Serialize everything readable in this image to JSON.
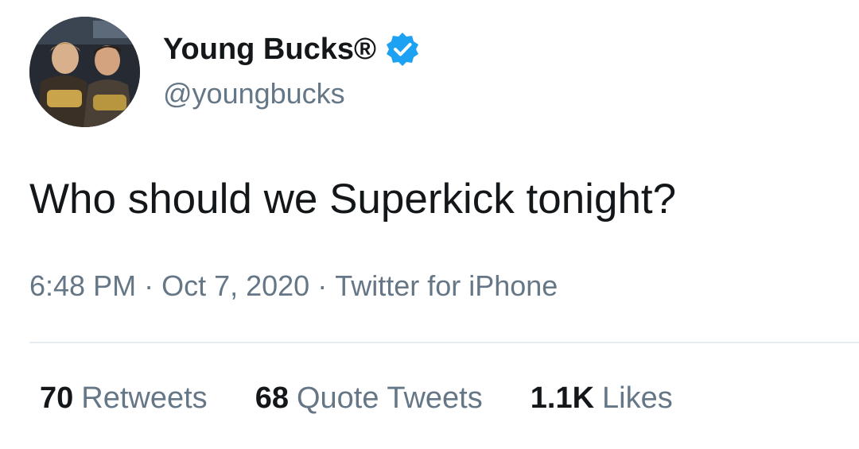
{
  "user": {
    "display_name": "Young Bucks®",
    "handle": "@youngbucks",
    "verified": true,
    "verified_color": "#1da1f2"
  },
  "tweet": {
    "text": "Who should we Superkick tonight?",
    "time": "6:48 PM",
    "date": "Oct 7, 2020",
    "source": "Twitter for iPhone",
    "separator": "·"
  },
  "stats": {
    "retweets_count": "70",
    "retweets_label": "Retweets",
    "quotes_count": "68",
    "quotes_label": "Quote Tweets",
    "likes_count": "1.1K",
    "likes_label": "Likes"
  },
  "icons": {
    "verified": "verified-badge-icon"
  },
  "colors": {
    "text": "#14171a",
    "secondary": "#657786",
    "divider": "#e6ecf0"
  }
}
